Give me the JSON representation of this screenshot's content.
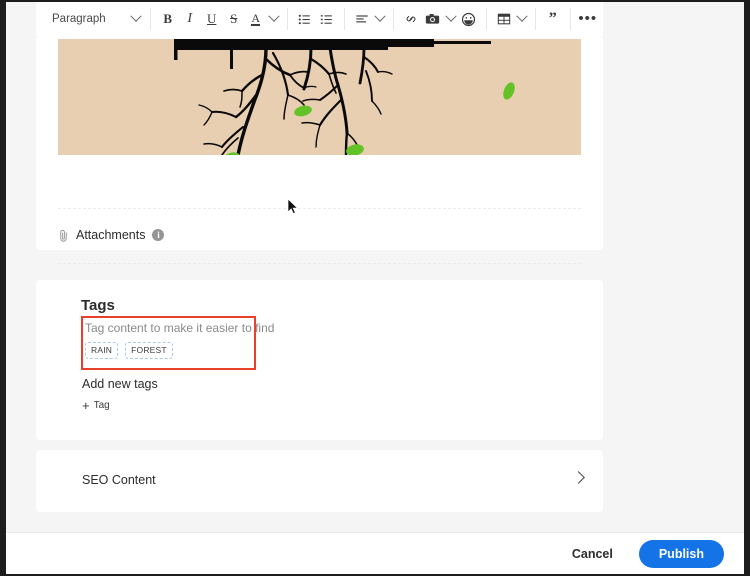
{
  "toolbar": {
    "style_select": {
      "value": "Paragraph",
      "caret": "chevron-down-icon"
    },
    "bold": "B",
    "italic": "I",
    "underline": "U",
    "strikethrough": "S",
    "text_color": "A",
    "bullet_list": "bulleted-list-icon",
    "numbered_list": "numbered-list-icon",
    "align": "align-left-icon",
    "link": "link-icon",
    "image": "camera-icon",
    "emoji": "emoji-icon",
    "table": "table-icon",
    "blockquote": "”",
    "more": "•••"
  },
  "hero": {
    "alt": "tree-roots-illustration",
    "bg_color": "#e9cfb2",
    "leaf_color": "#63c226"
  },
  "attachments": {
    "label": "Attachments",
    "clip_icon": "paperclip-icon",
    "info_icon": "info-icon"
  },
  "tags": {
    "title": "Tags",
    "hint": "Tag content to make it easier to find",
    "chips": [
      "RAIN",
      "FOREST"
    ],
    "add_new_label": "Add new tags",
    "add_tag_button": "Tag",
    "add_tag_plus": "+",
    "highlight_color": "#e8402a",
    "chip_border_color": "#a9c8ec"
  },
  "seo": {
    "label": "SEO Content",
    "chevron": "chevron-right-icon"
  },
  "footer": {
    "cancel_label": "Cancel",
    "publish_label": "Publish",
    "publish_color": "#1473e6"
  }
}
